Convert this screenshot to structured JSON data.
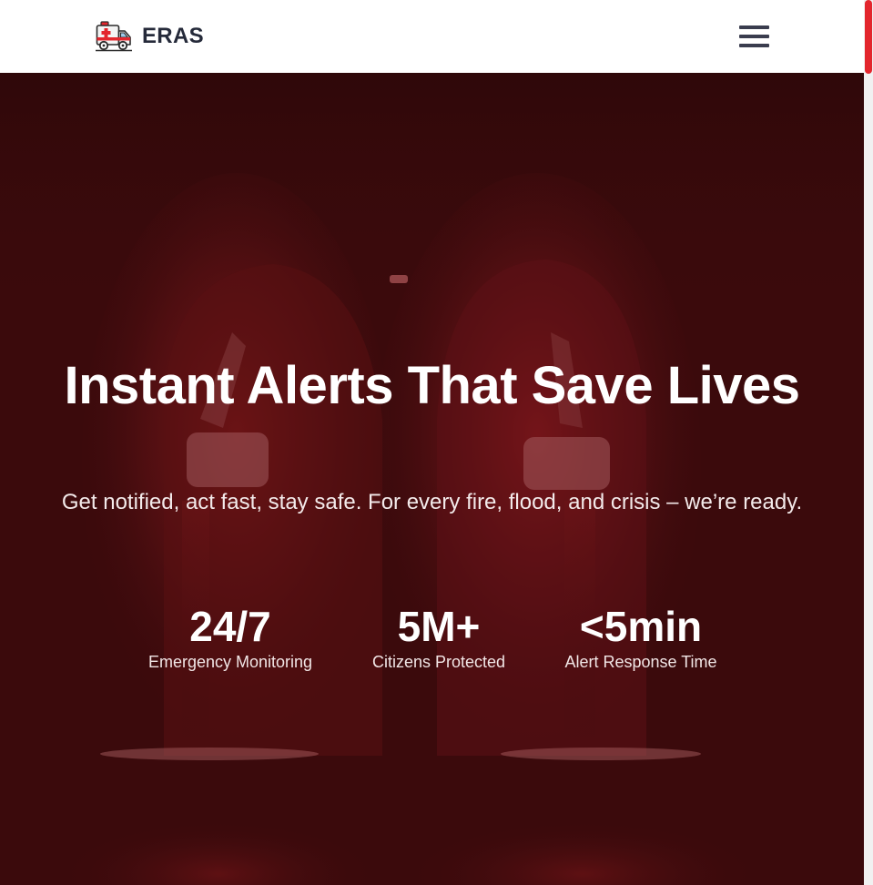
{
  "header": {
    "brand_name": "ERAS",
    "logo_icon": "ambulance-icon",
    "menu_icon": "hamburger-menu-icon"
  },
  "hero": {
    "title": "Instant Alerts That Save Lives",
    "subtitle": "Get notified, act fast, stay safe. For every fire, flood, and crisis – we’re ready.",
    "background": "emergency-siren-lights",
    "stats": [
      {
        "value": "24/7",
        "label": "Emergency Monitoring"
      },
      {
        "value": "5M+",
        "label": "Citizens Protected"
      },
      {
        "value": "<5min",
        "label": "Alert Response Time"
      }
    ]
  },
  "colors": {
    "header_bg": "#ffffff",
    "brand_text": "#252a3a",
    "hero_overlay": "#3a0a0c",
    "accent": "#e3262d",
    "hero_text": "#ffffff"
  }
}
